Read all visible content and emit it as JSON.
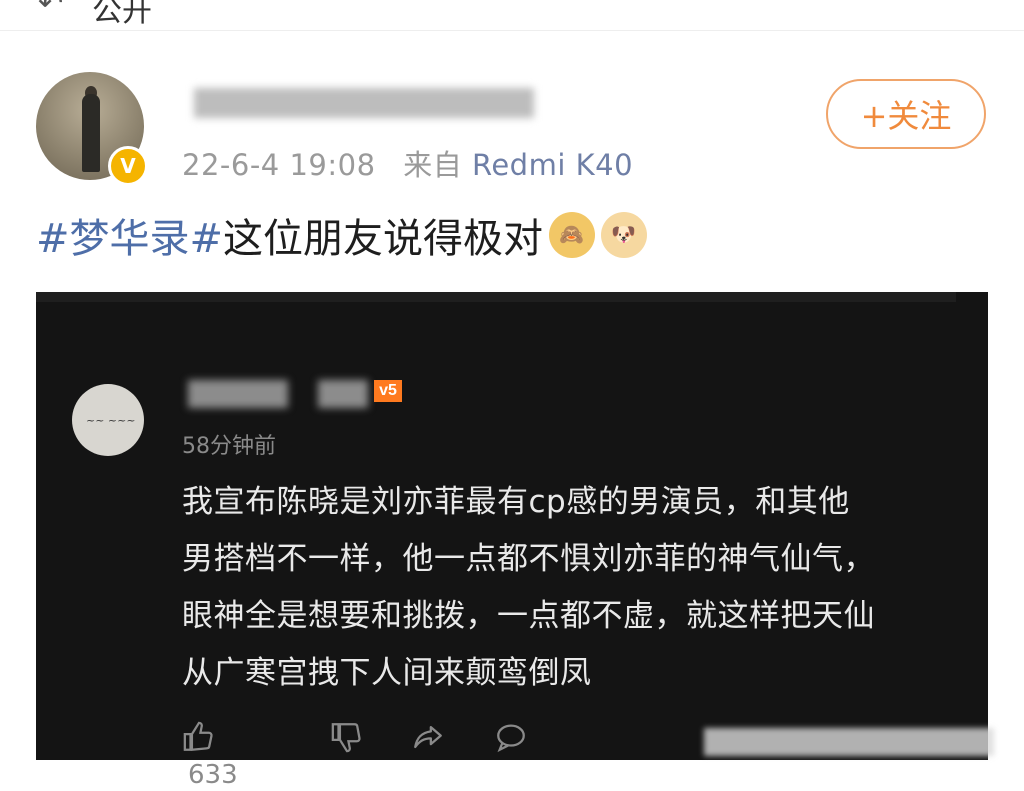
{
  "header": {
    "back_icon": "back-arrow-icon",
    "label": "公开"
  },
  "post": {
    "author_name_blurred": "",
    "timestamp": "22-6-4 19:08",
    "source_prefix": "来自",
    "source_device": "Redmi K40",
    "follow_label": "+关注",
    "hashtag": "#梦华录#",
    "text": "这位朋友说得极对",
    "emojis": [
      "covering-face-monkey-emoji",
      "doge-emoji"
    ],
    "verified_badge": "V"
  },
  "comment_screenshot": {
    "user_level_badge": "v5",
    "time_ago": "58分钟前",
    "text_lines": [
      "我宣布陈晓是刘亦菲最有cp感的男演员，和其他",
      "男搭档不一样，他一点都不惧刘亦菲的神气仙气，",
      "眼神全是想要和挑拨，一点都不虚，就这样把天仙",
      "从广寒宫拽下人间来颠鸾倒凤"
    ],
    "like_count": "633",
    "icons": [
      "thumbs-up-icon",
      "thumbs-down-icon",
      "share-icon",
      "comment-icon"
    ]
  },
  "colors": {
    "hashtag": "#4e6ea8",
    "follow_accent": "#f08a3c",
    "screenshot_bg": "#141414",
    "verified": "#f5b400"
  }
}
